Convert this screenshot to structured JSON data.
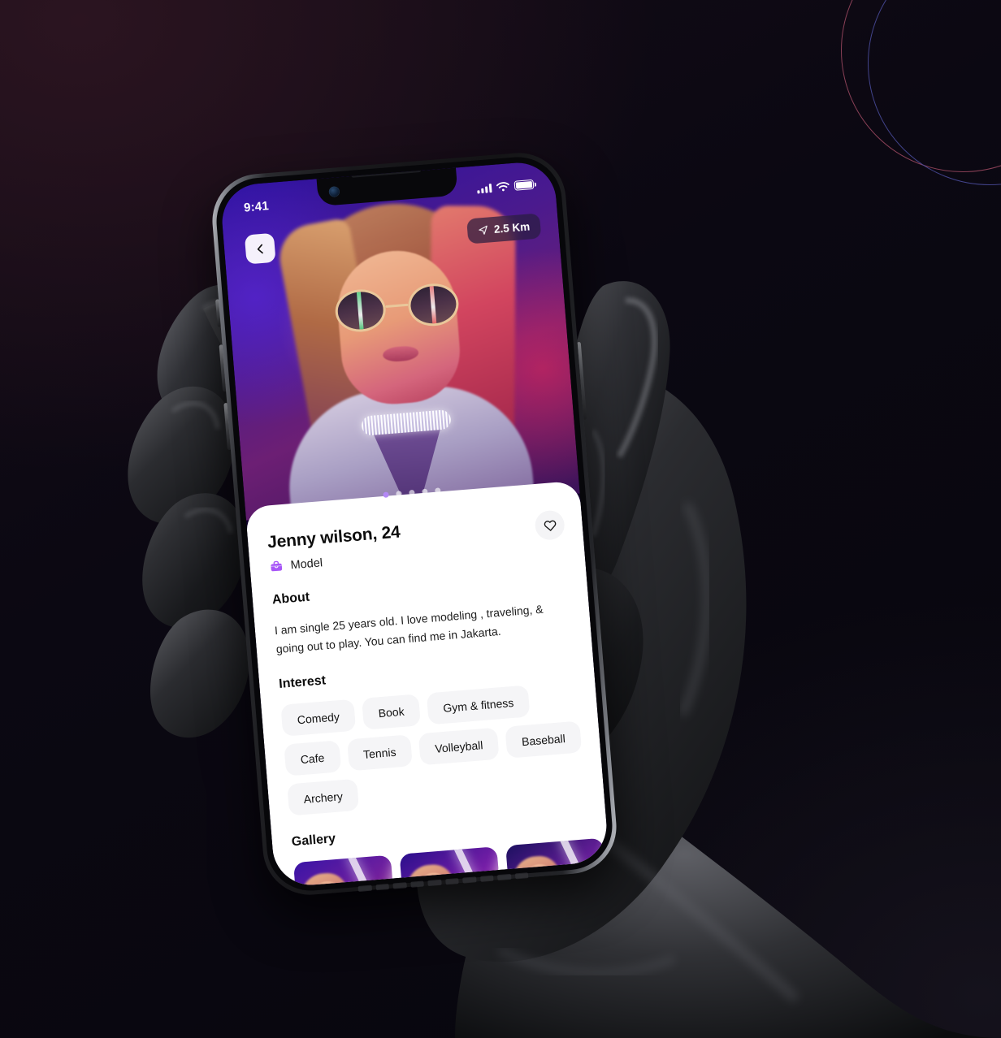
{
  "background": {
    "ring_outer_color": "#a04a63",
    "ring_inner_color": "#4b4ea0",
    "base_color": "#0a0711"
  },
  "device": {
    "status_bar": {
      "time": "9:41",
      "cellular_icon": "signal-bars-icon",
      "wifi_icon": "wifi-icon",
      "battery_icon": "battery-icon"
    }
  },
  "hero": {
    "back_button_icon": "chevron-left-icon",
    "distance_badge": {
      "icon": "navigation-arrow-icon",
      "label": "2.5 Km"
    },
    "carousel": {
      "total_dots": 5,
      "active_index": 0
    }
  },
  "profile": {
    "name": "Jenny wilson, 24",
    "job_icon": "briefcase-icon",
    "job": "Model",
    "favorite_icon": "heart-icon",
    "about_title": "About",
    "about_text": "I am single 25 years old. I love modeling , traveling, & going out to play. You can find me in Jakarta.",
    "interest_title": "Interest",
    "interests": [
      "Comedy",
      "Book",
      "Gym & fitness",
      "Cafe",
      "Tennis",
      "Volleyball",
      "Baseball",
      "Archery"
    ],
    "gallery_title": "Gallery",
    "gallery_count": 3,
    "accent_color": "#b388f5"
  }
}
